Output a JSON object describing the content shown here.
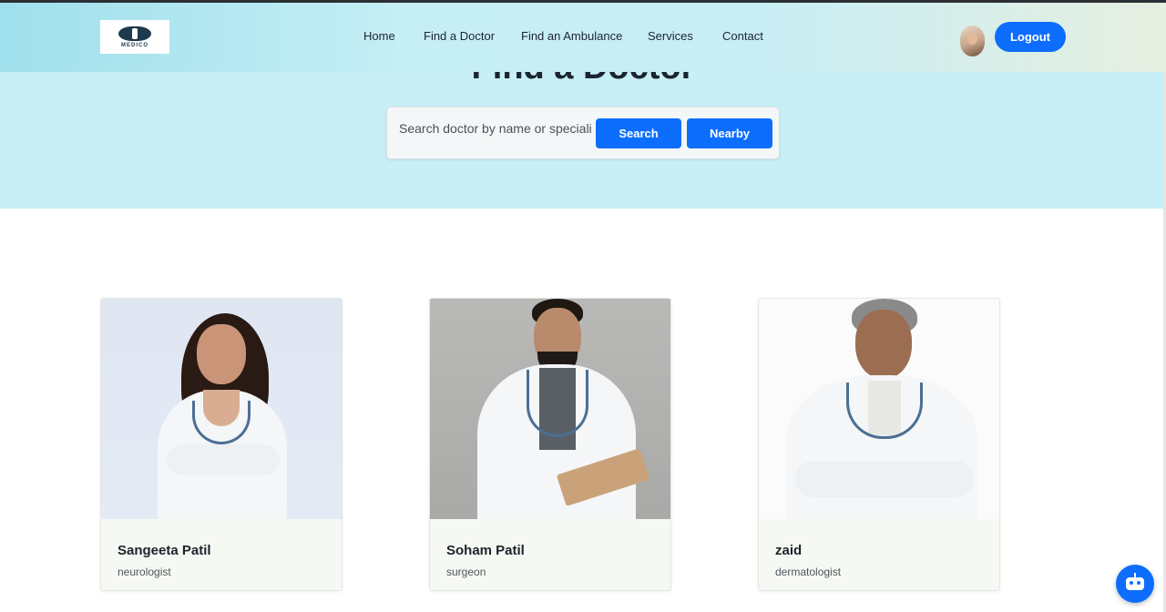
{
  "brand": {
    "logo_text": "MEDICO"
  },
  "nav": {
    "items": [
      {
        "label": "Home"
      },
      {
        "label": "Find a Doctor"
      },
      {
        "label": "Find an Ambulance"
      },
      {
        "label": "Services"
      },
      {
        "label": "Contact"
      }
    ]
  },
  "user": {
    "logout_label": "Logout",
    "avatar_icon": "user-avatar"
  },
  "hero": {
    "title": "Find a Doctor"
  },
  "search": {
    "placeholder": "Search doctor by name or specialization",
    "search_label": "Search",
    "nearby_label": "Nearby"
  },
  "doctors": [
    {
      "name": "Sangeeta Patil",
      "specialization": "neurologist"
    },
    {
      "name": "Soham Patil",
      "specialization": "surgeon"
    },
    {
      "name": "zaid",
      "specialization": "dermatologist"
    }
  ],
  "chatbot": {
    "icon": "robot-icon"
  },
  "colors": {
    "primary": "#0d6efd",
    "hero_bg": "#c9eff6",
    "card_body": "#f6f9f3"
  }
}
